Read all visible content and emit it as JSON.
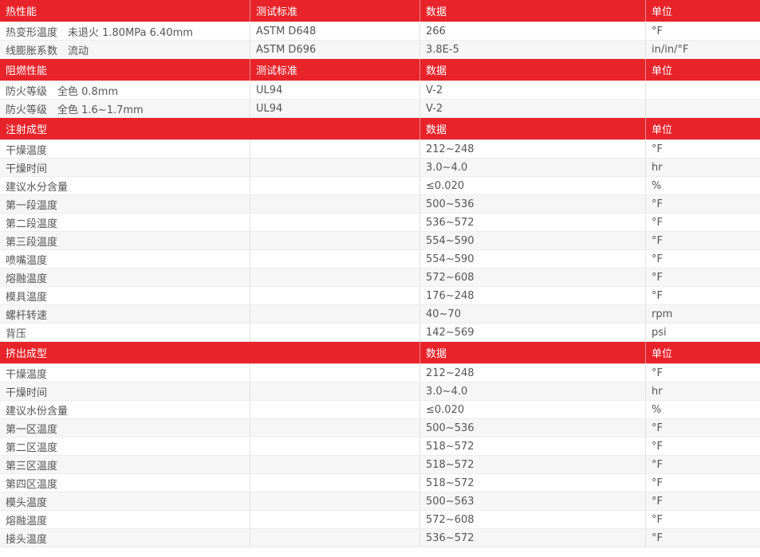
{
  "sections": [
    {
      "header": [
        "热性能",
        "测试标准",
        "数据",
        "单位"
      ],
      "rows": [
        [
          "热变形温度　未退火 1.80MPa 6.40mm",
          "ASTM D648",
          "266",
          "°F"
        ],
        [
          "线膨胀系数　流动",
          "ASTM D696",
          "3.8E-5",
          "in/in/°F"
        ]
      ]
    },
    {
      "header": [
        "阻燃性能",
        "测试标准",
        "数据",
        "单位"
      ],
      "rows": [
        [
          "防火等级　全色 0.8mm",
          "UL94",
          "V-2",
          ""
        ],
        [
          "防火等级　全色 1.6~1.7mm",
          "UL94",
          "V-2",
          ""
        ]
      ]
    },
    {
      "header": [
        "注射成型",
        "数据",
        "单位"
      ],
      "rows": [
        [
          "干燥温度",
          "",
          "212~248",
          "°F"
        ],
        [
          "干燥时间",
          "",
          "3.0~4.0",
          "hr"
        ],
        [
          "建议水分含量",
          "",
          "≤0.020",
          "%"
        ],
        [
          "第一段温度",
          "",
          "500~536",
          "°F"
        ],
        [
          "第二段温度",
          "",
          "536~572",
          "°F"
        ],
        [
          "第三段温度",
          "",
          "554~590",
          "°F"
        ],
        [
          "喷嘴温度",
          "",
          "554~590",
          "°F"
        ],
        [
          "熔融温度",
          "",
          "572~608",
          "°F"
        ],
        [
          "模具温度",
          "",
          "176~248",
          "°F"
        ],
        [
          "螺杆转速",
          "",
          "40~70",
          "rpm"
        ],
        [
          "背压",
          "",
          "142~569",
          "psi"
        ]
      ]
    },
    {
      "header": [
        "挤出成型",
        "数据",
        "单位"
      ],
      "rows": [
        [
          "干燥温度",
          "",
          "212~248",
          "°F"
        ],
        [
          "干燥时间",
          "",
          "3.0~4.0",
          "hr"
        ],
        [
          "建议水份含量",
          "",
          "≤0.020",
          "%"
        ],
        [
          "第一区温度",
          "",
          "500~536",
          "°F"
        ],
        [
          "第二区温度",
          "",
          "518~572",
          "°F"
        ],
        [
          "第三区温度",
          "",
          "518~572",
          "°F"
        ],
        [
          "第四区温度",
          "",
          "518~572",
          "°F"
        ],
        [
          "模头温度",
          "",
          "500~563",
          "°F"
        ],
        [
          "熔融温度",
          "",
          "572~608",
          "°F"
        ],
        [
          "接头温度",
          "",
          "536~572",
          "°F"
        ]
      ]
    }
  ]
}
